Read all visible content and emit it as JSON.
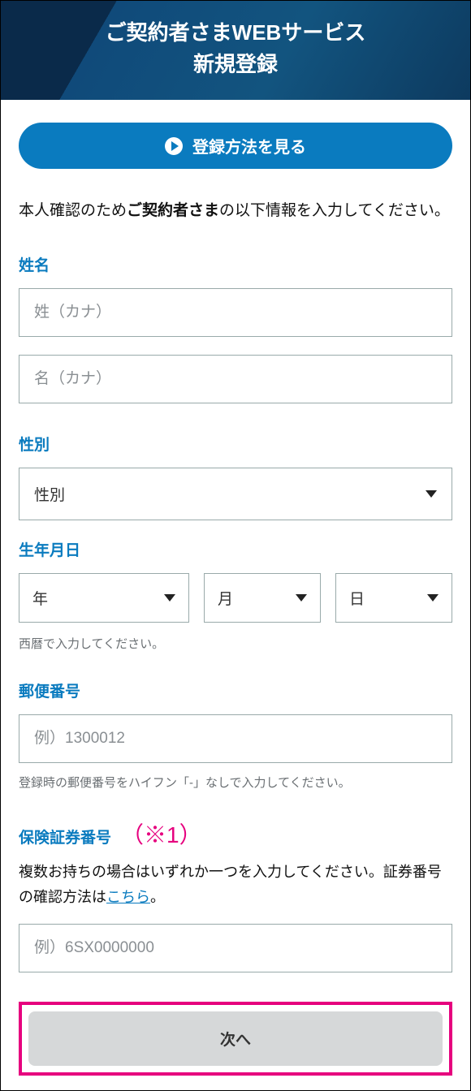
{
  "header_line1": "ご契約者さまWEBサービス",
  "header_line2": "新規登録",
  "guide_button": "登録方法を見る",
  "intro_pre": "本人確認のため",
  "intro_bold": "ご契約者さま",
  "intro_post": "の以下情報を入力してください。",
  "name": {
    "label": "姓名",
    "sei_ph": "姓（カナ）",
    "mei_ph": "名（カナ）"
  },
  "gender": {
    "label": "性別",
    "placeholder": "性別"
  },
  "dob": {
    "label": "生年月日",
    "year": "年",
    "month": "月",
    "day": "日",
    "hint": "西暦で入力してください。"
  },
  "postal": {
    "label": "郵便番号",
    "placeholder": "例）1300012",
    "hint": "登録時の郵便番号をハイフン「-」なしで入力してください。"
  },
  "policy": {
    "label": "保険証券番号",
    "marker": "（※1）",
    "note_pre": "複数お持ちの場合はいずれか一つを入力してください。証券番号の確認方法は",
    "link": "こちら",
    "note_post": "。",
    "placeholder": "例）6SX0000000"
  },
  "next": "次へ"
}
